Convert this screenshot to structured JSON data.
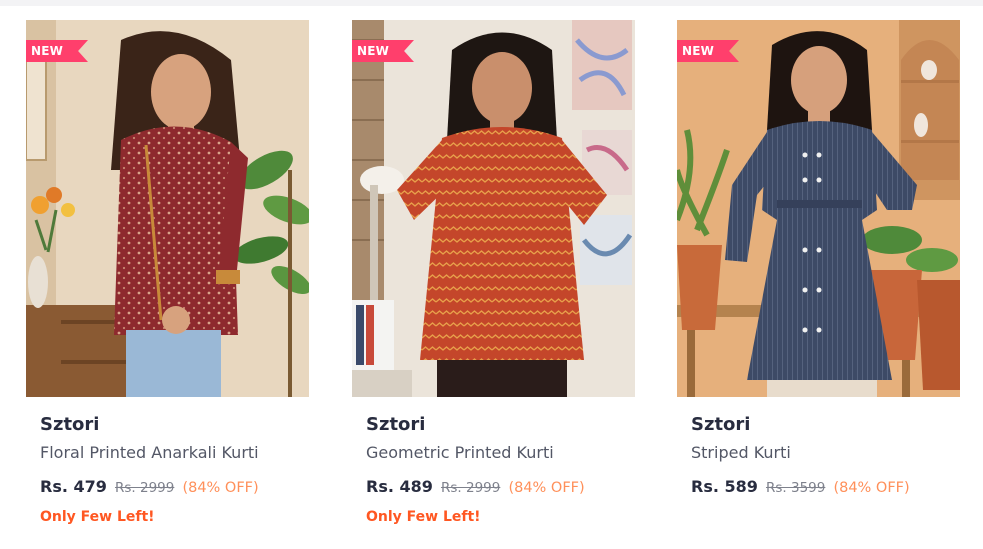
{
  "badge_color": "#ff3f6c",
  "products": [
    {
      "badge": "NEW",
      "brand": "Sztori",
      "name": "Floral Printed Anarkali Kurti",
      "price": "Rs. 479",
      "mrp": "Rs. 2999",
      "discount": "(84% OFF)",
      "stock_note": "Only Few Left!",
      "image_alt": "woman in maroon printed kurti",
      "garment_color": "#8e2a2e"
    },
    {
      "badge": "NEW",
      "brand": "Sztori",
      "name": "Geometric Printed Kurti",
      "price": "Rs. 489",
      "mrp": "Rs. 2999",
      "discount": "(84% OFF)",
      "stock_note": "Only Few Left!",
      "image_alt": "woman in orange chevron kurti",
      "garment_color": "#c4462a"
    },
    {
      "badge": "NEW",
      "brand": "Sztori",
      "name": "Striped Kurti",
      "price": "Rs. 589",
      "mrp": "Rs. 3599",
      "discount": "(84% OFF)",
      "image_alt": "woman in navy striped kurti",
      "garment_color": "#3d4a66"
    }
  ]
}
